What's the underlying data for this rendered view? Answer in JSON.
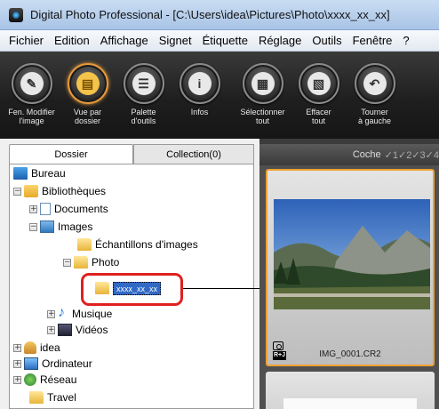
{
  "window": {
    "title": "Digital Photo Professional - [C:\\Users\\idea\\Pictures\\Photo\\xxxx_xx_xx]"
  },
  "menu": {
    "items": [
      "Fichier",
      "Edition",
      "Affichage",
      "Signet",
      "Étiquette",
      "Réglage",
      "Outils",
      "Fenêtre",
      "?"
    ]
  },
  "toolbar": {
    "buttons": [
      {
        "line1": "Fen. Modifier",
        "line2": "l'image",
        "icon": "edit-image-icon"
      },
      {
        "line1": "Vue par",
        "line2": "dossier",
        "icon": "folder-view-icon",
        "active": true
      },
      {
        "line1": "Palette",
        "line2": "d'outils",
        "icon": "tool-palette-icon"
      },
      {
        "line1": "Infos",
        "line2": "",
        "icon": "info-icon"
      },
      {
        "line1": "Sélectionner",
        "line2": "tout",
        "icon": "select-all-icon"
      },
      {
        "line1": "Effacer",
        "line2": "tout",
        "icon": "clear-all-icon"
      },
      {
        "line1": "Tourner",
        "line2": "à gauche",
        "icon": "rotate-left-icon"
      }
    ]
  },
  "left_panel": {
    "tabs": [
      "Dossier",
      "Collection(0)"
    ],
    "tree": [
      {
        "label": "Bureau",
        "icon": "desktop-icon"
      },
      {
        "label": "Bibliothèques",
        "icon": "libraries-icon",
        "expander": "−"
      },
      {
        "label": "Documents",
        "icon": "documents-icon",
        "expander": "+"
      },
      {
        "label": "Images",
        "icon": "pictures-icon",
        "expander": "−"
      },
      {
        "label": "Échantillons d'images",
        "icon": "folder-icon"
      },
      {
        "label": "Photo",
        "icon": "folder-icon",
        "expander": "−"
      },
      {
        "label": "xxxx_xx_xx",
        "icon": "folder-icon",
        "selected": true
      },
      {
        "label": "Musique",
        "icon": "music-icon",
        "expander": "+"
      },
      {
        "label": "Vidéos",
        "icon": "videos-icon",
        "expander": "+"
      },
      {
        "label": "idea",
        "icon": "user-folder-icon",
        "expander": "+"
      },
      {
        "label": "Ordinateur",
        "icon": "computer-icon",
        "expander": "+"
      },
      {
        "label": "Réseau",
        "icon": "network-icon",
        "expander": "+"
      },
      {
        "label": "Travel",
        "icon": "folder-icon"
      }
    ]
  },
  "right_panel": {
    "check_label": "Coche",
    "check_marks": "✓1✓2✓3✓4",
    "thumbnails": [
      {
        "filename": "IMG_0001.CR2",
        "badge": "R+J"
      }
    ]
  },
  "colors": {
    "selection": "#316ac5",
    "highlight_box": "#e02020",
    "thumb_border": "#f0a030",
    "toolbar_bg": "#1f1f1f"
  }
}
